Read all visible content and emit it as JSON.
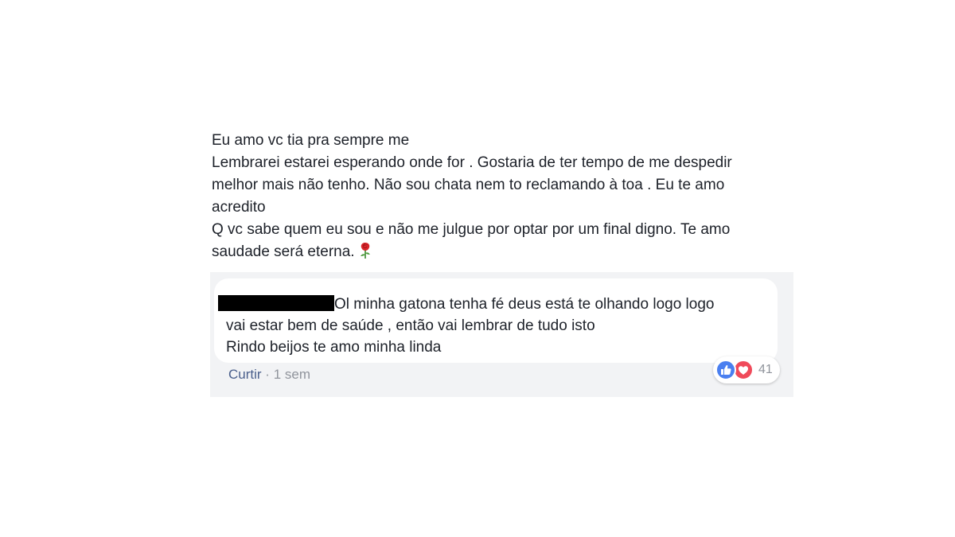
{
  "post": {
    "lines": [
      "Eu amo vc tia pra sempre me",
      "Lembrarei estarei esperando onde for . Gostaria de ter tempo de me despedir",
      "melhor mais não tenho. Não sou chata nem to reclamando à toa . Eu te amo",
      "acredito",
      "Q vc sabe quem eu sou e não me julgue por optar por um final digno. Te amo",
      "saudade será eterna."
    ],
    "emoji": "rose-emoji"
  },
  "comment": {
    "author": "",
    "lines": [
      "Ol minha gatona tenha fé deus está te olhando logo logo",
      "vai estar bem de saúde , então vai lembrar de tudo isto",
      "Rindo beijos te amo minha linda"
    ],
    "actions": {
      "like_label": "Curtir",
      "separator": "·",
      "time": "1 sem"
    },
    "reactions": {
      "count": "41",
      "icons": [
        "like-icon",
        "love-icon"
      ]
    }
  },
  "colors": {
    "text": "#1d2129",
    "muted": "#90949c",
    "comment_background": "#f2f3f5",
    "bubble_background": "#ffffff",
    "like_blue": "#4a7ff0",
    "love_red": "#f04a5a"
  }
}
